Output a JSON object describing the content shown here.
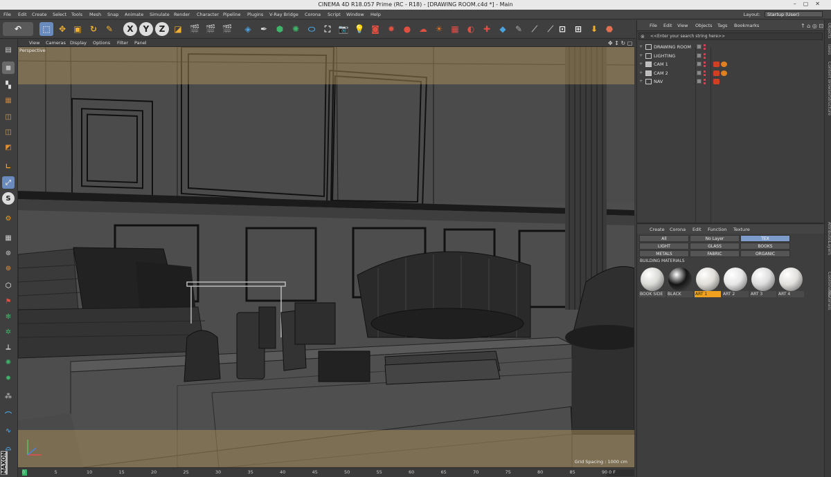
{
  "window": {
    "title": "CINEMA 4D R18.057 Prime (RC - R18) - [DRAWING ROOM.c4d *] - Main"
  },
  "menubar": {
    "items": [
      "File",
      "Edit",
      "Create",
      "Select",
      "Tools",
      "Mesh",
      "Snap",
      "Animate",
      "Simulate",
      "Render",
      "Character",
      "Pipeline",
      "Plugins",
      "V-Ray Bridge",
      "Corona",
      "Script",
      "Window",
      "Help"
    ],
    "layout_label": "Layout:",
    "layout_value": "Startup (User)"
  },
  "viewport": {
    "menu": [
      "View",
      "Cameras",
      "Display",
      "Options",
      "Filter",
      "Panel"
    ],
    "label": "Perspective",
    "grid_spacing": "Grid Spacing : 1000 cm"
  },
  "timeline": {
    "ticks": [
      "0",
      "5",
      "10",
      "15",
      "20",
      "25",
      "30",
      "35",
      "40",
      "45",
      "50",
      "55",
      "60",
      "65",
      "70",
      "75",
      "80",
      "85",
      "90"
    ],
    "frame": "0 F"
  },
  "object_manager": {
    "menu": [
      "File",
      "Edit",
      "View",
      "Objects",
      "Tags",
      "Bookmarks"
    ],
    "search_placeholder": "<<Enter your search string here>>",
    "objects": [
      {
        "name": "DRAWING ROOM",
        "icon": "layer-icon"
      },
      {
        "name": "LIGHTING",
        "icon": "layer-icon"
      },
      {
        "name": "CAM 1",
        "icon": "camera-icon"
      },
      {
        "name": "CAM 2",
        "icon": "camera-icon"
      },
      {
        "name": "NAV",
        "icon": "null-icon"
      }
    ]
  },
  "material_manager": {
    "menu": [
      "Create",
      "Corona",
      "Edit",
      "Function",
      "Texture"
    ],
    "layers": [
      {
        "label": "All",
        "active": false
      },
      {
        "label": "No Layer",
        "active": false
      },
      {
        "label": "TEX",
        "active": true
      },
      {
        "label": "LIGHT",
        "active": false
      },
      {
        "label": "GLASS",
        "active": false
      },
      {
        "label": "BOOKS",
        "active": false
      },
      {
        "label": "METALS",
        "active": false
      },
      {
        "label": "FABRIC",
        "active": false
      },
      {
        "label": "ORGANIC",
        "active": false
      }
    ],
    "group_label": "BUILDING MATERIALS",
    "materials": [
      {
        "name": "BOOK SIDE",
        "color": "#d9d9d6",
        "selected": false
      },
      {
        "name": "BLACK",
        "color": "#151515",
        "selected": false
      },
      {
        "name": "ART 1",
        "color": "#e0ddd8",
        "selected": true
      },
      {
        "name": "ART 2",
        "color": "#e6e6e6",
        "selected": false
      },
      {
        "name": "ART 3",
        "color": "#dcdcdc",
        "selected": false
      },
      {
        "name": "ART 4",
        "color": "#e2e0dd",
        "selected": false
      }
    ]
  },
  "right_tabs": [
    "Objects",
    "Takes",
    "Content Browser",
    "Structure",
    "Attributes",
    "Layers",
    "Coordinates",
    "Materials"
  ],
  "colors": {
    "accent_selected": "#f0a020",
    "tex_layer": "#7d9ccc",
    "viewport_bg": "#4b4b4b",
    "tint": "#b9995a"
  }
}
